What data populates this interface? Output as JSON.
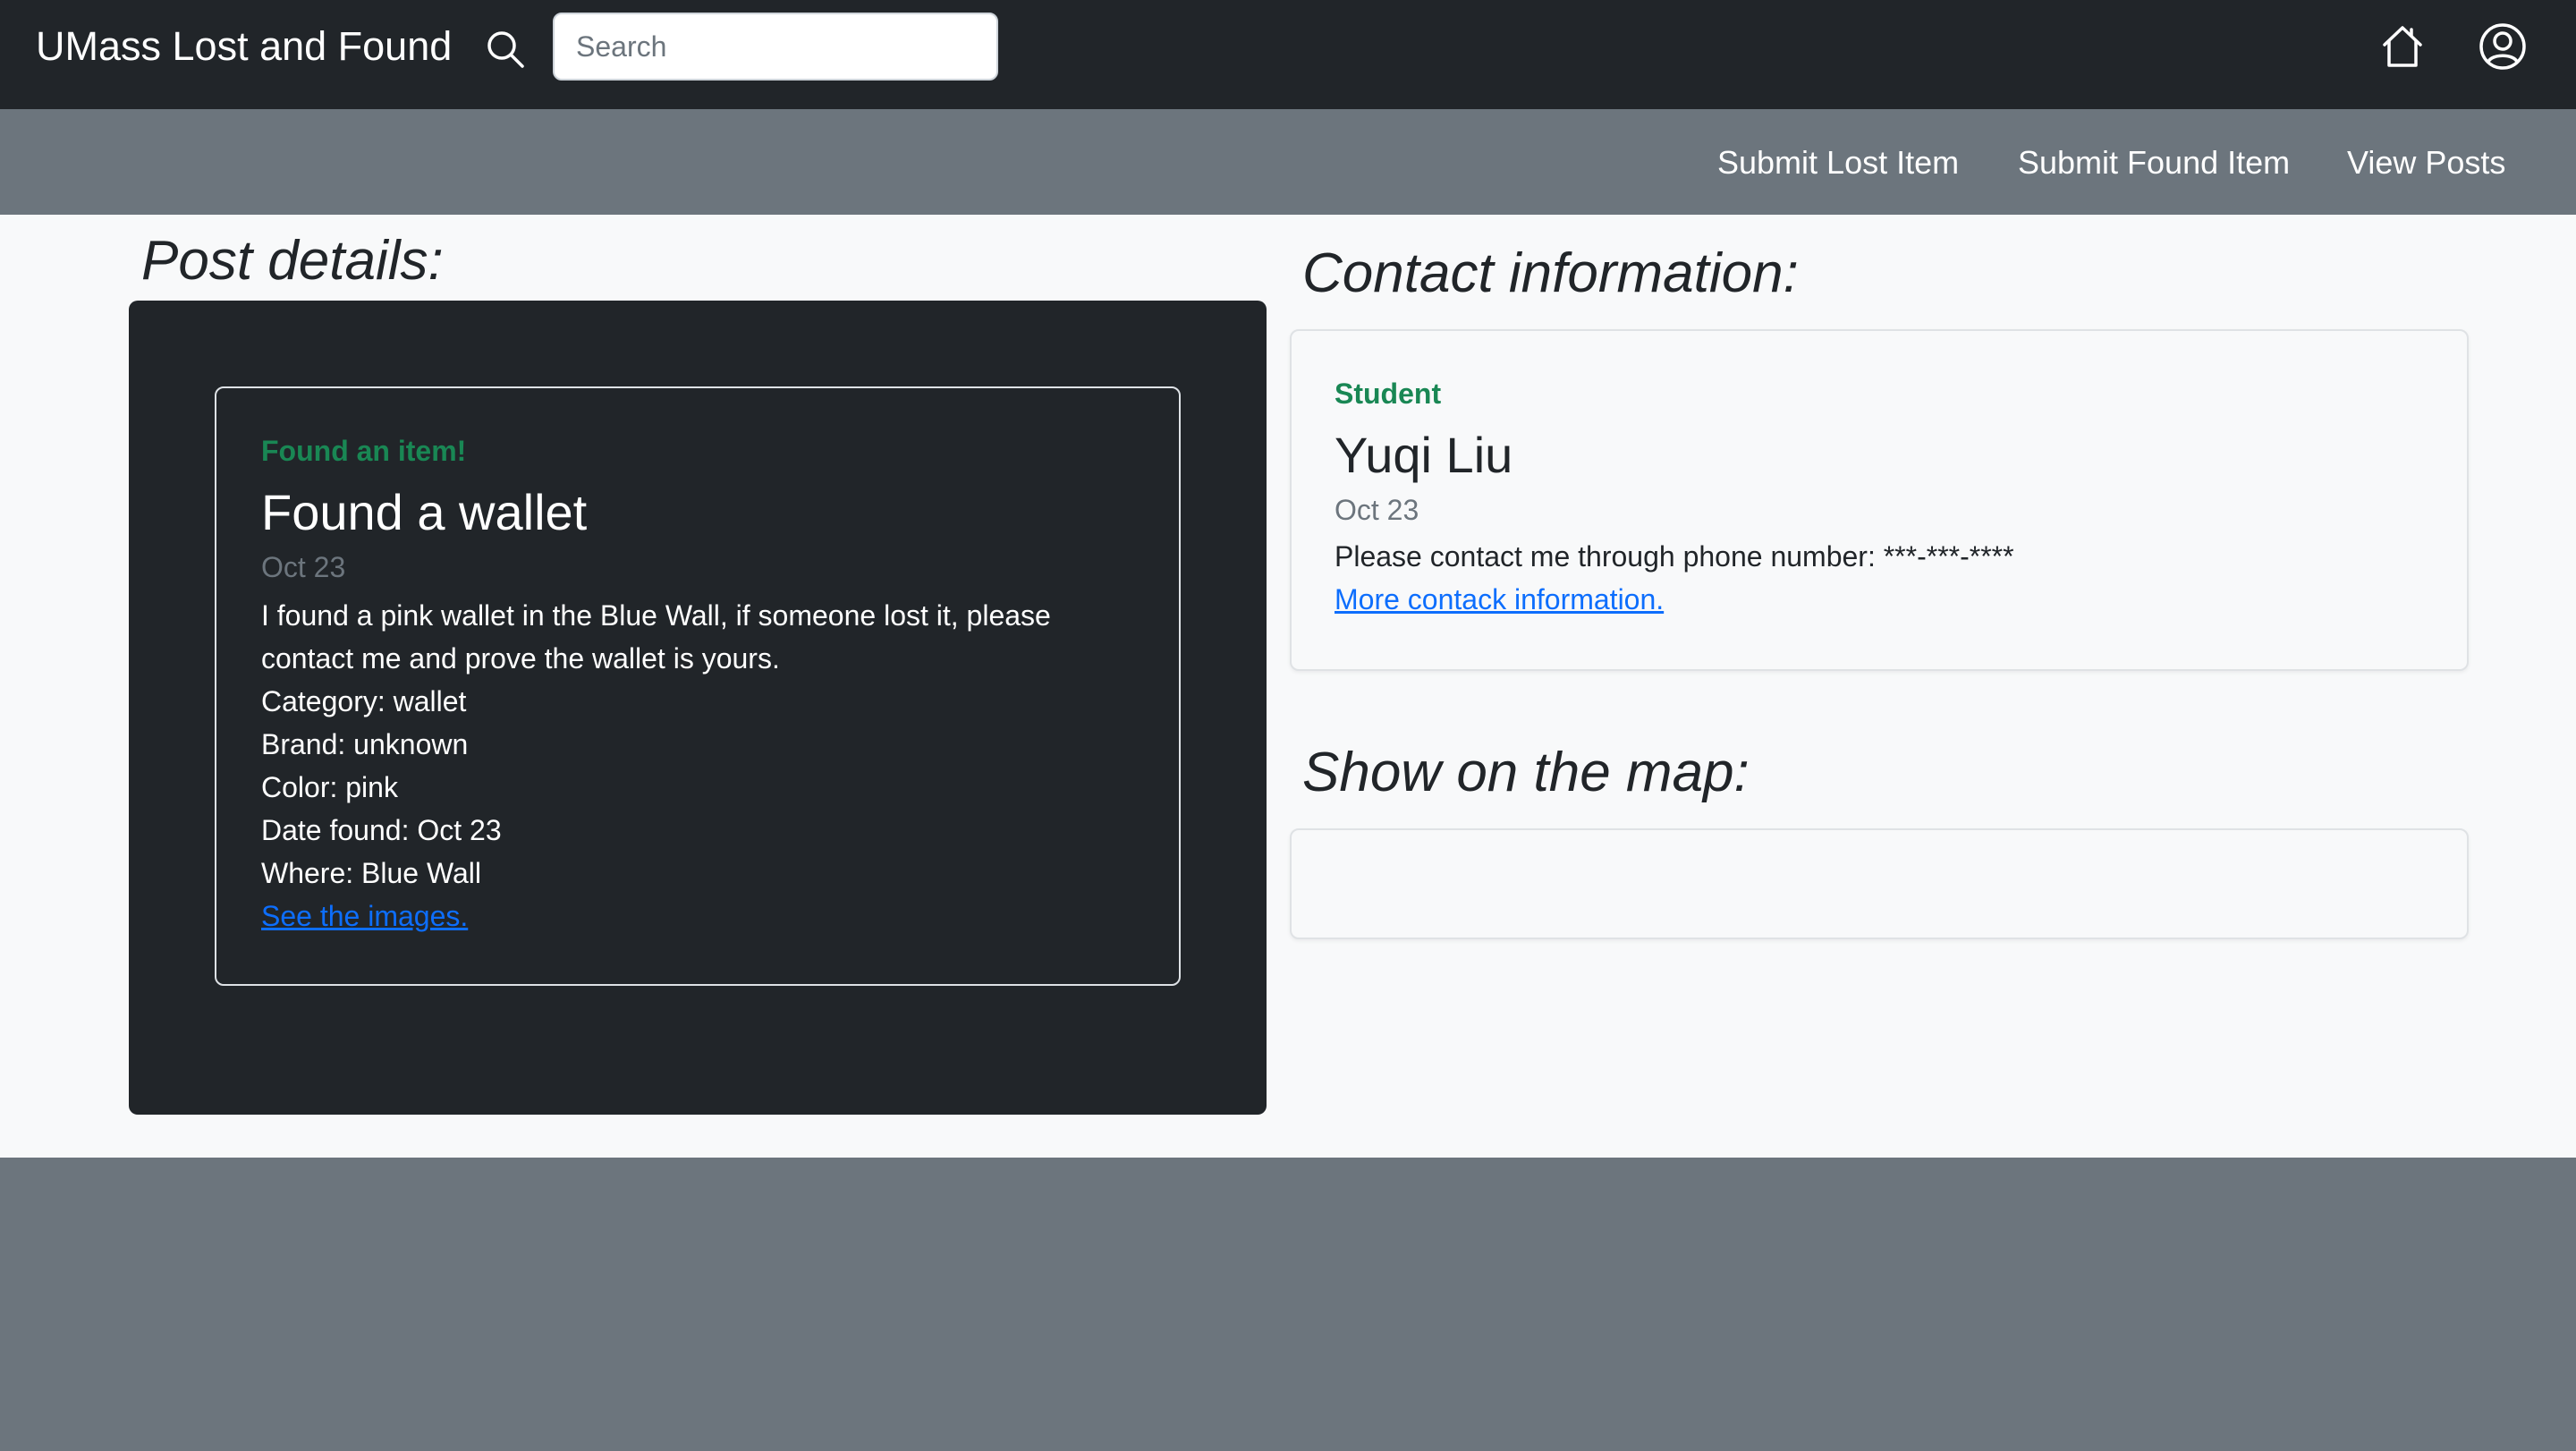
{
  "header": {
    "brand": "UMass Lost and Found",
    "search_placeholder": "Search",
    "search_value": ""
  },
  "subnav": {
    "items": [
      {
        "label": "Submit Lost Item"
      },
      {
        "label": "Submit Found Item"
      },
      {
        "label": "View Posts"
      }
    ]
  },
  "post": {
    "section_title": "Post details:",
    "subtitle": "Found an item!",
    "title": "Found a wallet",
    "date": "Oct 23",
    "description": "I found a pink wallet in the Blue Wall, if someone lost it, please contact me and prove the wallet is yours.",
    "category": "Category: wallet",
    "brand": "Brand: unknown",
    "color": "Color: pink",
    "date_found": "Date found: Oct 23",
    "where": "Where: Blue Wall",
    "images_link": "See the images."
  },
  "contact": {
    "section_title": "Contact information:",
    "role": "Student",
    "name": "Yuqi Liu",
    "date": "Oct 23",
    "message": "Please contact me through phone number: ***-***-****",
    "more_link": "More contack information."
  },
  "map": {
    "section_title": "Show on the map:"
  },
  "colors": {
    "navbar": "#212529",
    "subnav": "#6c757d",
    "success": "#198754",
    "link": "#0d6efd",
    "page_bg": "#f8f9fa"
  },
  "icons": {
    "search": "search-icon",
    "home": "home-icon",
    "user": "user-circle-icon"
  }
}
